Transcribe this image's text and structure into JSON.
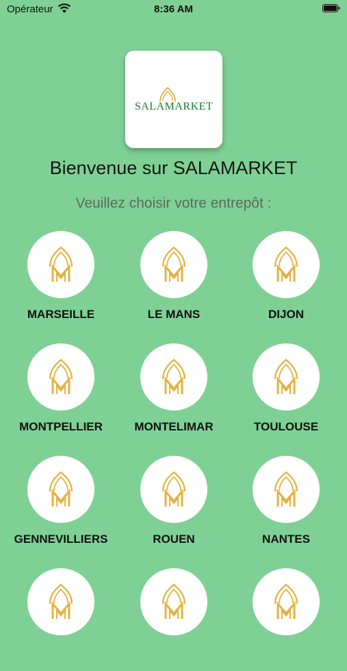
{
  "status_bar": {
    "carrier": "Opérateur",
    "time": "8:36 AM"
  },
  "logo": {
    "text": "SALAMARKET",
    "brand_color": "#1f7a32",
    "accent_color": "#e0a83a"
  },
  "welcome_title": "Bienvenue sur SALAMARKET",
  "subtitle": "Veuillez choisir votre entrepôt :",
  "colors": {
    "background": "#7fd094",
    "tile": "#ffffff",
    "icon": "#e6b13e"
  },
  "warehouses": [
    {
      "name": "MARSEILLE",
      "icon": "salamarket-dome-icon"
    },
    {
      "name": "LE MANS",
      "icon": "salamarket-dome-icon"
    },
    {
      "name": "DIJON",
      "icon": "salamarket-dome-icon"
    },
    {
      "name": "MONTPELLIER",
      "icon": "salamarket-dome-icon"
    },
    {
      "name": "MONTELIMAR",
      "icon": "salamarket-dome-icon"
    },
    {
      "name": "TOULOUSE",
      "icon": "salamarket-dome-icon"
    },
    {
      "name": "GENNEVILLIERS",
      "icon": "salamarket-dome-icon"
    },
    {
      "name": "ROUEN",
      "icon": "salamarket-dome-icon"
    },
    {
      "name": "NANTES",
      "icon": "salamarket-dome-icon"
    },
    {
      "name": "",
      "icon": "salamarket-dome-icon"
    },
    {
      "name": "",
      "icon": "salamarket-dome-icon"
    },
    {
      "name": "",
      "icon": "salamarket-dome-icon"
    }
  ]
}
